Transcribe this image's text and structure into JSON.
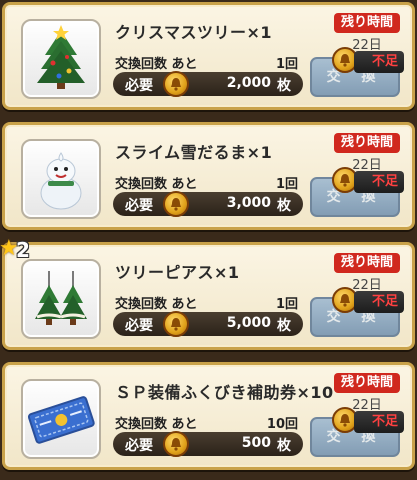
{
  "items": [
    {
      "name": "クリスマスツリー×1",
      "exchange_label": "交換回数 あと",
      "exchange_count": "1回",
      "required_label": "必要",
      "cost": "2,000",
      "unit": "枚",
      "remaining_label": "残り時間",
      "remaining_value": "22日",
      "button_label": "交 換",
      "status": "不足",
      "icon": "christmas-tree-icon",
      "star": null
    },
    {
      "name": "スライム雪だるま×1",
      "exchange_label": "交換回数 あと",
      "exchange_count": "1回",
      "required_label": "必要",
      "cost": "3,000",
      "unit": "枚",
      "remaining_label": "残り時間",
      "remaining_value": "22日",
      "button_label": "交 換",
      "status": "不足",
      "icon": "slime-snowman-icon",
      "star": null
    },
    {
      "name": "ツリーピアス×1",
      "exchange_label": "交換回数 あと",
      "exchange_count": "1回",
      "required_label": "必要",
      "cost": "5,000",
      "unit": "枚",
      "remaining_label": "残り時間",
      "remaining_value": "22日",
      "button_label": "交 換",
      "status": "不足",
      "icon": "tree-earrings-icon",
      "star": "2"
    },
    {
      "name": "ＳＰ装備ふくびき補助券×10",
      "exchange_label": "交換回数 あと",
      "exchange_count": "10回",
      "required_label": "必要",
      "cost": "500",
      "unit": "枚",
      "remaining_label": "残り時間",
      "remaining_value": "22日",
      "button_label": "交 換",
      "status": "不足",
      "icon": "lottery-ticket-icon",
      "star": null
    }
  ],
  "colors": {
    "remaining_bg": "#d0281e",
    "status_text": "#ff4040",
    "card_border": "#c9a24a",
    "button_bg": "#6f93bb"
  }
}
